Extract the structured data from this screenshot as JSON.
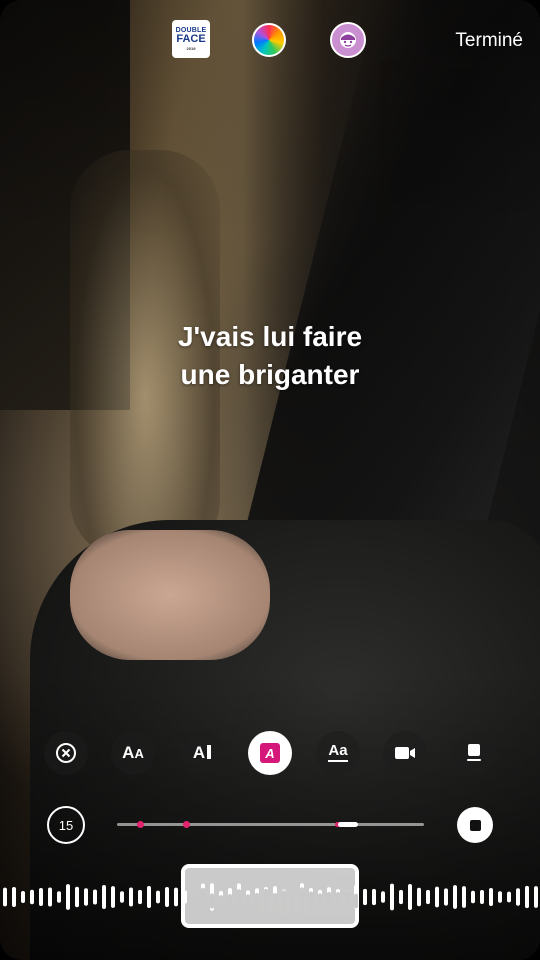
{
  "top_bar": {
    "logo_text_line1": "DOUBLE",
    "logo_text_line2": "FACE",
    "logo_text_line3": "2019",
    "color_picker_icon": "color-wheel-icon",
    "sticker_icon": "face-sticker-icon",
    "done_label": "Terminé"
  },
  "caption": {
    "line1": "J'vais lui faire",
    "line2": "une briganter"
  },
  "toolbar": {
    "tools": [
      {
        "name": "close-icon",
        "label": "⊗"
      },
      {
        "name": "text-size-icon",
        "label": "Aa"
      },
      {
        "name": "text-animate-icon",
        "label": "A▌"
      },
      {
        "name": "text-style-icon",
        "label": "A",
        "active": true
      },
      {
        "name": "text-underline-icon",
        "label": "Aa"
      },
      {
        "name": "video-icon",
        "label": ""
      },
      {
        "name": "sticker-position-icon",
        "label": ""
      }
    ]
  },
  "timeline": {
    "duration_label": "15",
    "accent_color": "#e1246d"
  }
}
